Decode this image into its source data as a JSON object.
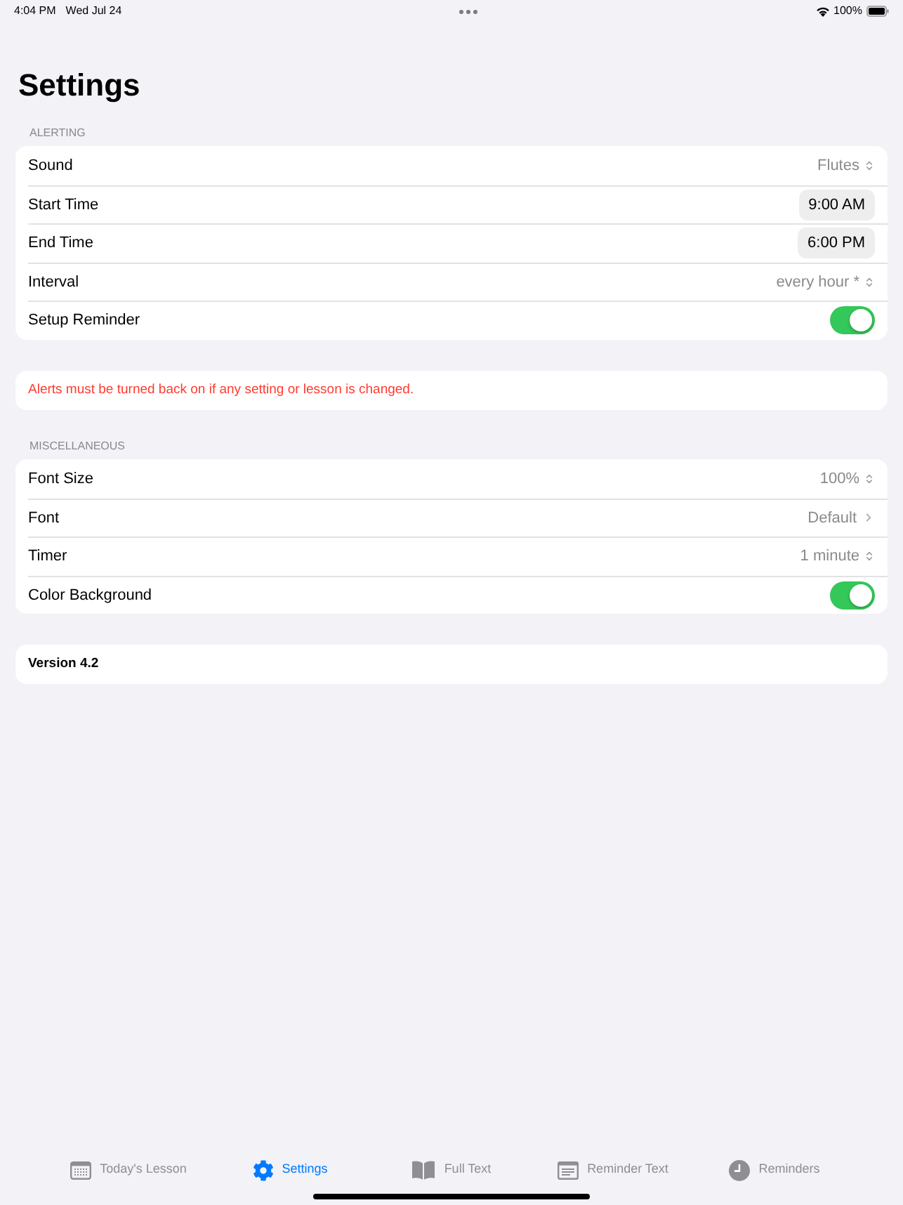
{
  "status_bar": {
    "time": "4:04 PM",
    "date": "Wed Jul 24",
    "battery": "100%"
  },
  "title": "Settings",
  "sections": [
    {
      "kind": "list",
      "header": "ALERTING",
      "rows": [
        {
          "kind": "picker",
          "label": "Sound",
          "value": "Flutes"
        },
        {
          "kind": "time",
          "label": "Start Time",
          "value": "9:00 AM"
        },
        {
          "kind": "time",
          "label": "End Time",
          "value": "6:00 PM"
        },
        {
          "kind": "picker",
          "label": "Interval",
          "value": "every hour *"
        },
        {
          "kind": "toggle",
          "label": "Setup Reminder",
          "on": true
        }
      ]
    },
    {
      "kind": "note",
      "text": "Alerts must be turned back on if any setting or lesson is changed."
    },
    {
      "kind": "list",
      "header": "MISCELLANEOUS",
      "rows": [
        {
          "kind": "picker",
          "label": "Font Size",
          "value": "100%"
        },
        {
          "kind": "link",
          "label": "Font",
          "value": "Default"
        },
        {
          "kind": "picker",
          "label": "Timer",
          "value": "1 minute"
        },
        {
          "kind": "toggle",
          "label": "Color Background",
          "on": true
        }
      ]
    },
    {
      "kind": "footer",
      "text": "Version 4.2"
    }
  ],
  "tab_bar": [
    {
      "label": "Today's Lesson",
      "selected": false
    },
    {
      "label": "Settings",
      "selected": true
    },
    {
      "label": "Full Text",
      "selected": false
    },
    {
      "label": "Reminder Text",
      "selected": false
    },
    {
      "label": "Reminders",
      "selected": false
    }
  ]
}
